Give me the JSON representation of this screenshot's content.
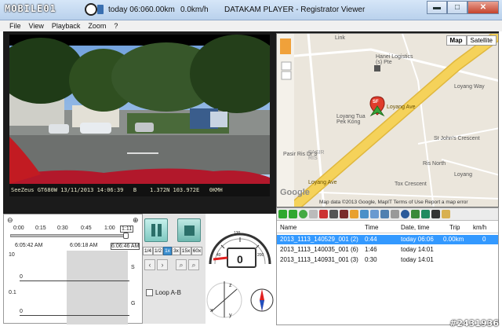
{
  "window": {
    "logo": "MOBILE01",
    "title_time": "today 06:06",
    "title_dist": "0.00km",
    "title_speed": "0.0km/h",
    "title": "DATAKAM PLAYER - Registrator Viewer",
    "buttons": {
      "minimize": "▬",
      "maximize": "□",
      "close": "✕"
    }
  },
  "menu": [
    "File",
    "View",
    "Playback",
    "Zoom",
    "?"
  ],
  "video": {
    "osd": "SeeZeus GT680W 13/11/2013 14:06:39   B    1.372N 103.972E   0KMH"
  },
  "map": {
    "buttons": [
      "Map",
      "Satellite"
    ],
    "selected": "Map",
    "labels": {
      "link": "Link",
      "hanei": "Hanei Logistics\n(s) Pte",
      "loyang_tua": "Loyang Tua\nPek Kong",
      "loyang_way": "Loyang Way",
      "loyang_ave": "Loyang Ave",
      "loyang_ave2": "Loyang Ave",
      "pasir_ris": "PASIR\nRIS",
      "pasir_ris_dr3": "Pasir Ris Dr 3",
      "tox_crescent": "Tox Crescent",
      "st_john": "St John's Crescent",
      "ris_north": "Ris North",
      "google": "Google",
      "loyang": "Loyang"
    },
    "marker_label": "SF",
    "data_notice": "Map data ©2013 Google, MapIT  Terms of Use  Report a map error"
  },
  "timeline": {
    "ticks": [
      "0:00",
      "0:15",
      "0:30",
      "0:45",
      "1:00"
    ],
    "current": "1:11",
    "times": [
      "6:05:42 AM",
      "6:06:18 AM",
      "6:06:46 AM"
    ],
    "y_top": "10",
    "y_mid": "0",
    "y_low": "0.1",
    "y_bot": "0",
    "lane_s": "S",
    "lane_g": "G"
  },
  "controls": {
    "speeds": [
      "1/4",
      "1/2",
      "1x",
      "3x",
      "15x",
      "60x"
    ],
    "selected_speed": "1x",
    "loop_label": "Loop A-B"
  },
  "gauge": {
    "speed": "0",
    "unit": "km/h",
    "marks": [
      "0",
      "20",
      "40",
      "60",
      "80",
      "100",
      "120",
      "140",
      "160",
      "180",
      "200"
    ],
    "axes": {
      "x": "x",
      "y": "y",
      "z": "z"
    }
  },
  "file_list": {
    "columns": [
      "Name",
      "Time",
      "Date, time",
      "Trip",
      "km/h"
    ],
    "rows": [
      {
        "name": "2013_1113_140529_001 (2)",
        "time": "0:44",
        "date": "today 06:06",
        "trip": "0.00km",
        "speed": "0",
        "selected": true
      },
      {
        "name": "2013_1113_140035_001 (6)",
        "time": "1:46",
        "date": "today 14:01",
        "trip": "",
        "speed": "",
        "selected": false
      },
      {
        "name": "2013_1113_140931_001 (3)",
        "time": "0:30",
        "date": "today 14:01",
        "trip": "",
        "speed": "",
        "selected": false
      }
    ]
  },
  "watermark": "#2431936",
  "colors": {
    "accent": "#3399ff",
    "road": "#f5d25a",
    "marker": "#e03c2c"
  }
}
